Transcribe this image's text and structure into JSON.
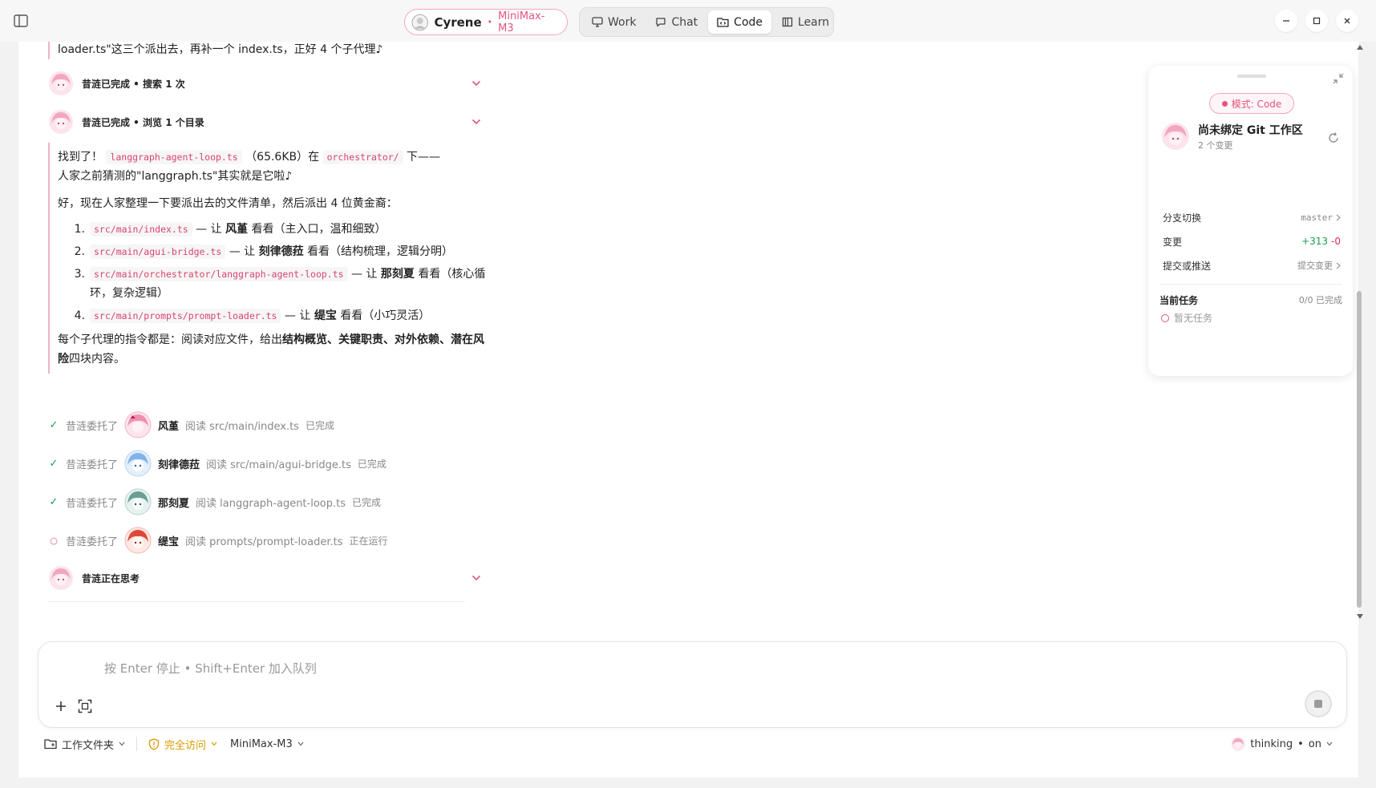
{
  "titlebar": {
    "persona_name": "Cyrene",
    "persona_sep": "•",
    "persona_model": "MiniMax-M3",
    "tabs": [
      {
        "label": "Work",
        "icon": "monitor-icon"
      },
      {
        "label": "Chat",
        "icon": "chat-bubble-icon"
      },
      {
        "label": "Code",
        "icon": "code-folder-icon",
        "active": true
      },
      {
        "label": "Learn",
        "icon": "book-icon"
      }
    ]
  },
  "chat": {
    "intro_line": "loader.ts\"这三个派出去，再补一个 index.ts，正好 4 个子代理♪",
    "status_search": "昔涟已完成 • 搜索 1 次",
    "status_browse": "昔涟已完成 • 浏览 1 个目录",
    "found": {
      "prefix": "找到了！",
      "file_code": "langgraph-agent-loop.ts",
      "size": "（65.6KB）在",
      "dir_code": "orchestrator/",
      "suffix": "下——",
      "line2": "人家之前猜测的\"langgraph.ts\"其实就是它啦♪"
    },
    "plan_intro": "好，现在人家整理一下要派出去的文件清单，然后派出 4 位黄金裔：",
    "tasks": [
      {
        "num": "1.",
        "code": "src/main/index.ts",
        "mid": " — 让 ",
        "agent": "风堇",
        "desc": " 看看（主入口，温和细致）"
      },
      {
        "num": "2.",
        "code": "src/main/agui-bridge.ts",
        "mid": " — 让 ",
        "agent": "刻律德菈",
        "desc": " 看看（结构梳理，逻辑分明）"
      },
      {
        "num": "3.",
        "code": "src/main/orchestrator/langgraph-agent-loop.ts",
        "mid": " — 让 ",
        "agent": "那刻夏",
        "desc": " 看看（核心循环，复杂逻辑）"
      },
      {
        "num": "4.",
        "code": "src/main/prompts/prompt-loader.ts",
        "mid": " — 让 ",
        "agent": "缇宝",
        "desc": " 看看（小巧灵活）"
      }
    ],
    "instruction": {
      "prefix": "每个子代理的指令都是：阅读对应文件，给出",
      "bold": "结构概览、关键职责、对外依赖、潜在风险",
      "suffix": "四块内容。"
    },
    "delegations": [
      {
        "mark": "✓",
        "who": "昔涟委托了",
        "agent": "风堇",
        "action": "阅读 src/main/index.ts",
        "state": "已完成",
        "avatar": "pink-hair-avatar-icon"
      },
      {
        "mark": "✓",
        "who": "昔涟委托了",
        "agent": "刻律德菈",
        "action": "阅读 src/main/agui-bridge.ts",
        "state": "已完成",
        "avatar": "blue-hair-avatar-icon"
      },
      {
        "mark": "✓",
        "who": "昔涟委托了",
        "agent": "那刻夏",
        "action": "阅读 langgraph-agent-loop.ts",
        "state": "已完成",
        "avatar": "teal-hair-avatar-icon"
      },
      {
        "mark": "○",
        "who": "昔涟委托了",
        "agent": "缇宝",
        "action": "阅读 prompts/prompt-loader.ts",
        "state": "正在运行",
        "avatar": "red-hair-avatar-icon"
      }
    ],
    "status_thinking": "昔涟正在思考"
  },
  "git_panel": {
    "mode_label": "模式: Code",
    "workspace_title": "尚未绑定 Git 工作区",
    "workspace_sub": "2 个变更",
    "branch_label": "分支切换",
    "branch_value": "master",
    "changes_label": "变更",
    "changes_plus": "+313",
    "changes_minus": "-0",
    "commit_label": "提交或推送",
    "commit_value": "提交变更",
    "tasks_title": "当前任务",
    "tasks_count": "0/0 已完成",
    "tasks_empty": "暂无任务"
  },
  "composer": {
    "placeholder": "按 Enter 停止 • Shift+Enter 加入队列"
  },
  "bottom_bar": {
    "folder_label": "工作文件夹",
    "access_label": "完全访问",
    "model_label": "MiniMax-M3",
    "thinking_label": "thinking",
    "thinking_sep": "•",
    "thinking_value": "on"
  },
  "colors": {
    "accent_pink": "#e0567e",
    "success_green": "#1a9c4b",
    "danger_red": "#d6334f",
    "warn_yellow": "#d99a00"
  }
}
